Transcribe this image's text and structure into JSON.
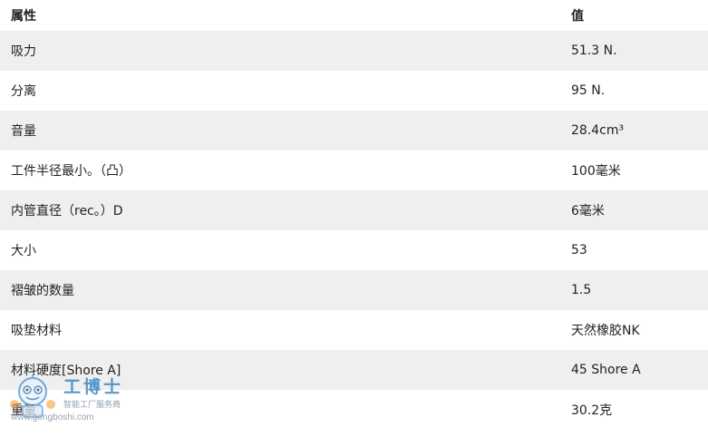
{
  "table": {
    "header": {
      "attribute": "属性",
      "value": "值"
    },
    "rows": [
      {
        "attribute": "吸力",
        "value": "51.3 N."
      },
      {
        "attribute": "分离",
        "value": "95 N."
      },
      {
        "attribute": "音量",
        "value": "28.4cm³"
      },
      {
        "attribute": "工件半径最小。（凸）",
        "value": "100毫米"
      },
      {
        "attribute": "内管直径（rec。）D",
        "value": "6毫米"
      },
      {
        "attribute": "大小",
        "value": "53"
      },
      {
        "attribute": "褶皱的数量",
        "value": "1.5"
      },
      {
        "attribute": "吸垫材料",
        "value": "天然橡胶NK"
      },
      {
        "attribute": "材料硬度[Shore A]",
        "value": "45 Shore A"
      },
      {
        "attribute": "重量",
        "value": "30.2克"
      }
    ]
  },
  "watermark": {
    "title": "工博士",
    "subtitle": "智能工厂服务商",
    "url": "www.gongboshi.com",
    "color": "#2d7fc1"
  }
}
